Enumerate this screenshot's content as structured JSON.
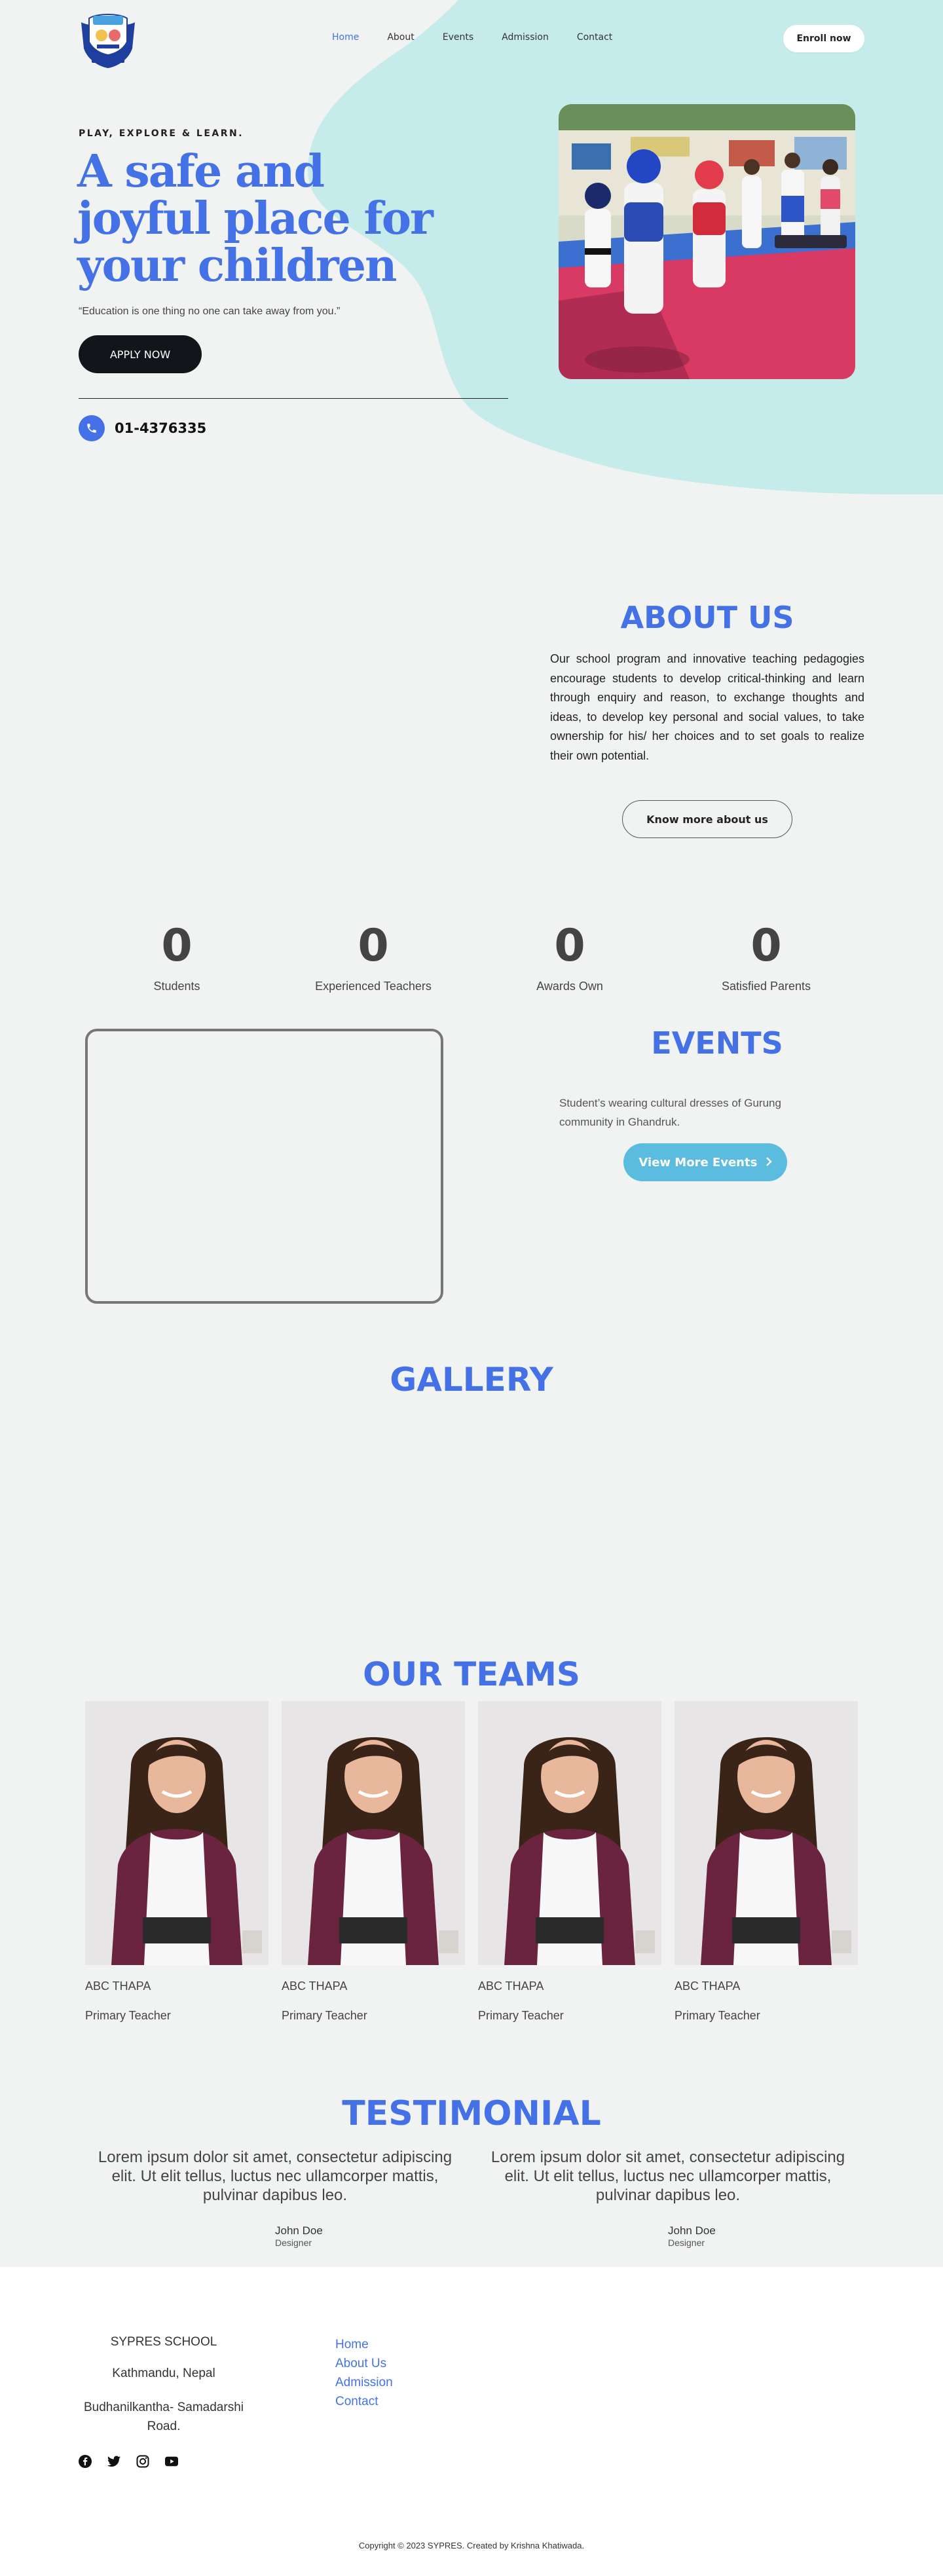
{
  "nav": {
    "links": [
      {
        "label": "Home",
        "active": true
      },
      {
        "label": "About",
        "active": false
      },
      {
        "label": "Events",
        "active": false
      },
      {
        "label": "Admission",
        "active": false
      },
      {
        "label": "Contact",
        "active": false
      }
    ],
    "enroll_label": "Enroll now"
  },
  "hero": {
    "tagline": "PLAY, EXPLORE & LEARN.",
    "headline": "A safe and joyful place for your children",
    "quote": "“Education is one thing no one can take away from you.”",
    "apply_label": "APPLY NOW",
    "phone": "01-4376335"
  },
  "about": {
    "title": "ABOUT US",
    "text": "Our school program and innovative teaching pedagogies encourage students to develop critical-thinking and learn through enquiry and reason, to exchange thoughts and ideas, to develop key personal and social values, to take ownership for his/ her choices and to set goals to realize their own potential.",
    "button_label": "Know more about us"
  },
  "stats": [
    {
      "value": "0",
      "label": "Students"
    },
    {
      "value": "0",
      "label": "Experienced Teachers"
    },
    {
      "value": "0",
      "label": "Awards Own"
    },
    {
      "value": "0",
      "label": "Satisfied Parents"
    }
  ],
  "events": {
    "title": "EVENTS",
    "description": "Student’s wearing cultural dresses of Gurung community in Ghandruk.",
    "button_label": "View More Events"
  },
  "gallery": {
    "title": "GALLERY"
  },
  "teams": {
    "title": "OUR TEAMS",
    "members": [
      {
        "name": "ABC THAPA",
        "role": "Primary Teacher"
      },
      {
        "name": "ABC THAPA",
        "role": "Primary Teacher"
      },
      {
        "name": "ABC THAPA",
        "role": "Primary Teacher"
      },
      {
        "name": "ABC THAPA",
        "role": "Primary Teacher"
      }
    ]
  },
  "testimonial": {
    "title": "TESTIMONIAL",
    "items": [
      {
        "text": "Lorem ipsum dolor sit amet, consectetur adipiscing elit. Ut elit tellus, luctus nec ullamcorper mattis, pulvinar dapibus leo.",
        "name": "John Doe",
        "role": "Designer"
      },
      {
        "text": "Lorem ipsum dolor sit amet, consectetur adipiscing elit. Ut elit tellus, luctus nec ullamcorper mattis, pulvinar dapibus leo.",
        "name": "John Doe",
        "role": "Designer"
      }
    ]
  },
  "footer": {
    "school": "SYPRES SCHOOL",
    "city": "Kathmandu, Nepal",
    "road": "Budhanilkantha- Samadarshi Road.",
    "links": [
      "Home",
      "About Us",
      "Admission",
      "Contact"
    ],
    "socials": [
      "facebook-icon",
      "twitter-icon",
      "instagram-icon",
      "youtube-icon"
    ],
    "copyright": "Copyright © 2023 SYPRES. Created by Krishna Khatiwada."
  },
  "colors": {
    "accent": "#4472e6",
    "blob": "#c5ecea",
    "dark_button": "#12161b",
    "events_button": "#5bbcdf",
    "background": "#f1f3f2"
  }
}
